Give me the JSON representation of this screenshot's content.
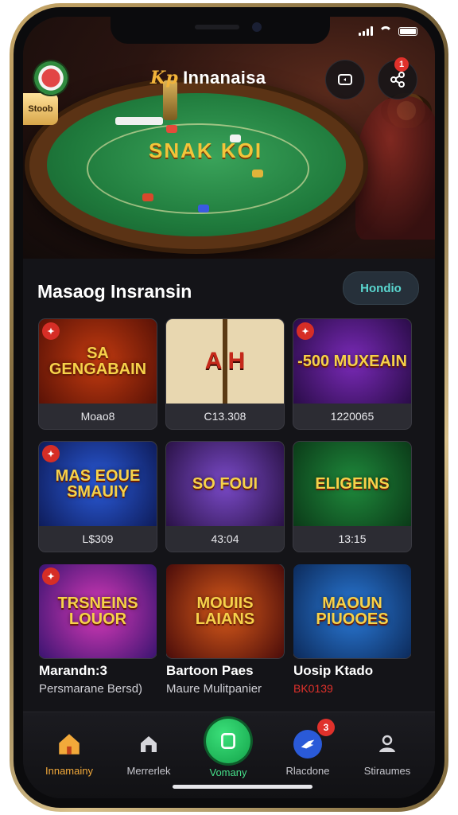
{
  "app": {
    "logo_mark": "Kp",
    "title": "Innanaisa"
  },
  "hero": {
    "badge": "Stoob",
    "table_text": "SNAK KOI"
  },
  "header_buttons": {
    "left_icon": "screen-rotate-icon",
    "right_icon": "share-network-icon",
    "right_badge": "1"
  },
  "section": {
    "title": "Masaog Insransin",
    "pill": "Hondio"
  },
  "games_row1": [
    {
      "art": "SA GENGABAIN",
      "caption": "Moao8",
      "color_a": "#c43b10",
      "color_b": "#5a1206"
    },
    {
      "art": "A H",
      "caption": "C13.308",
      "color_a": "#c69a4a",
      "color_b": "#5a3a14"
    },
    {
      "art": "-500 MUXEAIN",
      "caption": "1220065",
      "color_a": "#7a2ab8",
      "color_b": "#2a0c48"
    }
  ],
  "games_row2": [
    {
      "art": "MAS EOUE SMAUIY",
      "caption": "L$309",
      "color_a": "#2a5ad8",
      "color_b": "#0e1c5a"
    },
    {
      "art": "SO FOUI",
      "caption": "43:04",
      "color_a": "#7a4ac8",
      "color_b": "#2a1246"
    },
    {
      "art": "ELIGEINS",
      "caption": "13:15",
      "color_a": "#1f8a3c",
      "color_b": "#0b3a18"
    }
  ],
  "games_row3": [
    {
      "art": "TRSNEINS LOUOR",
      "title": "Marandn:3",
      "subtitle": "Persmarane Bersd)",
      "color_a": "#d83ab8",
      "color_b": "#3a1470"
    },
    {
      "art": "MOUIIS LAIANS",
      "title": "Bartoon Paes",
      "subtitle": "Maure Mulitpanier",
      "color_a": "#d85a1a",
      "color_b": "#4a0c0a"
    },
    {
      "art": "MAOUN PIUOOES",
      "title": "Uosip Ktado",
      "subtitle": "BK0139",
      "color_a": "#2a7ad8",
      "color_b": "#0c2a5a"
    }
  ],
  "tabs": [
    {
      "label": "Innamainy",
      "icon": "home-icon",
      "active": true
    },
    {
      "label": "Merrerlek",
      "icon": "house-outline-icon",
      "active": false
    },
    {
      "label": "Vomany",
      "icon": "square-icon",
      "active": false
    },
    {
      "label": "Rlacdone",
      "icon": "bird-icon",
      "badge": "3",
      "active": false
    },
    {
      "label": "Stiraumes",
      "icon": "user-icon",
      "active": false
    }
  ],
  "colors": {
    "accent_orange": "#f2a93a",
    "accent_green": "#2fcf6a",
    "badge_red": "#e0312b",
    "pill_text": "#5ad7d0"
  }
}
